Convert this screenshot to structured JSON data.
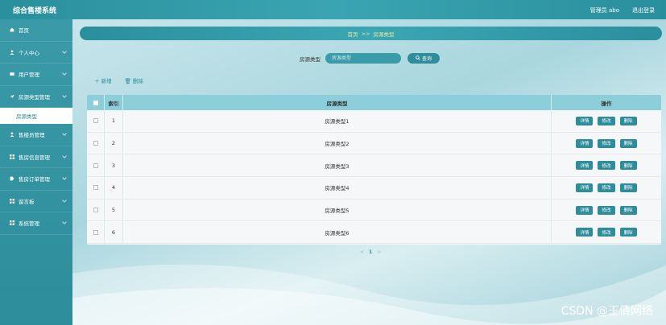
{
  "app": {
    "title": "综合售楼系统"
  },
  "topbar": {
    "user": "管理员 abo",
    "logout": "退出登录"
  },
  "sidebar": {
    "items": [
      {
        "label": "首页",
        "icon": "home-icon"
      },
      {
        "label": "个人中心",
        "icon": "user-icon"
      },
      {
        "label": "用户管理",
        "icon": "id-card-icon"
      },
      {
        "label": "房源类型管理",
        "icon": "send-icon"
      },
      {
        "label": "房源类型",
        "icon": ""
      },
      {
        "label": "售楼员管理",
        "icon": "person-icon"
      },
      {
        "label": "售房信息管理",
        "icon": "grid-icon"
      },
      {
        "label": "售房订单管理",
        "icon": "tag-icon"
      },
      {
        "label": "留言板",
        "icon": "grid-icon"
      },
      {
        "label": "系统管理",
        "icon": "grid-icon"
      }
    ]
  },
  "breadcrumb": {
    "home": "首页",
    "sep": ">>",
    "current": "房源类型"
  },
  "search": {
    "label": "房源类型",
    "placeholder": "房源类型",
    "button": "查询"
  },
  "actions": {
    "add": "＋ 新增",
    "delete": "删除"
  },
  "table": {
    "headers": {
      "index": "索引",
      "name": "房源类型",
      "ops": "操作"
    },
    "rows": [
      {
        "index": "1",
        "name": "房源类型1"
      },
      {
        "index": "2",
        "name": "房源类型2"
      },
      {
        "index": "3",
        "name": "房源类型3"
      },
      {
        "index": "4",
        "name": "房源类型4"
      },
      {
        "index": "5",
        "name": "房源类型5"
      },
      {
        "index": "6",
        "name": "房源类型6"
      }
    ],
    "buttons": {
      "detail": "详情",
      "edit": "修改",
      "delete": "删除"
    }
  },
  "pager": {
    "prev": "<",
    "page": "1",
    "next": ">"
  },
  "watermark": "CSDN @王倩网络"
}
